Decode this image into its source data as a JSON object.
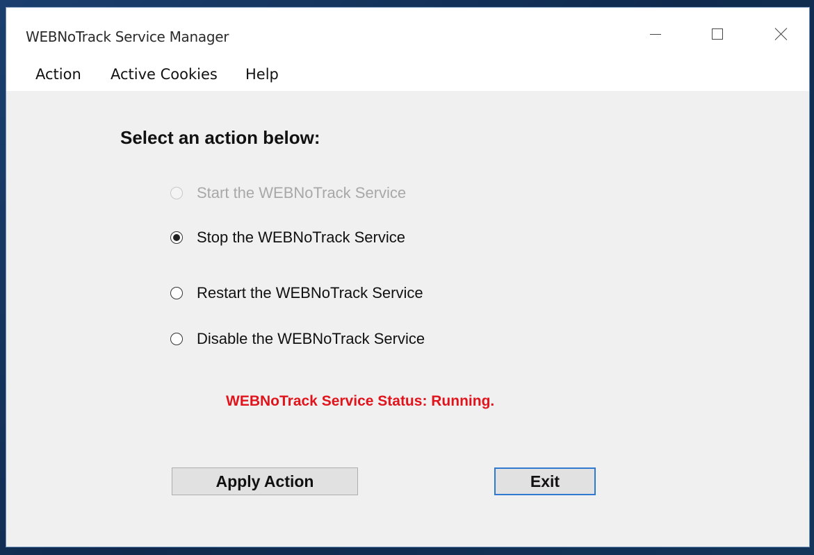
{
  "window": {
    "title": "WEBNoTrack Service Manager"
  },
  "menu": {
    "items": [
      {
        "label": "Action"
      },
      {
        "label": "Active Cookies"
      },
      {
        "label": "Help"
      }
    ]
  },
  "main": {
    "heading": "Select an action below:",
    "options": [
      {
        "label": "Start the WEBNoTrack Service",
        "selected": false,
        "disabled": true
      },
      {
        "label": "Stop the WEBNoTrack Service",
        "selected": true,
        "disabled": false
      },
      {
        "label": "Restart the WEBNoTrack Service",
        "selected": false,
        "disabled": false
      },
      {
        "label": "Disable the WEBNoTrack Service",
        "selected": false,
        "disabled": false
      }
    ],
    "status": "WEBNoTrack Service Status: Running.",
    "status_color": "#e0141c"
  },
  "buttons": {
    "apply_label": "Apply Action",
    "exit_label": "Exit"
  },
  "icons": {
    "minimize": "minimize-icon",
    "maximize": "maximize-icon",
    "close": "close-icon"
  }
}
